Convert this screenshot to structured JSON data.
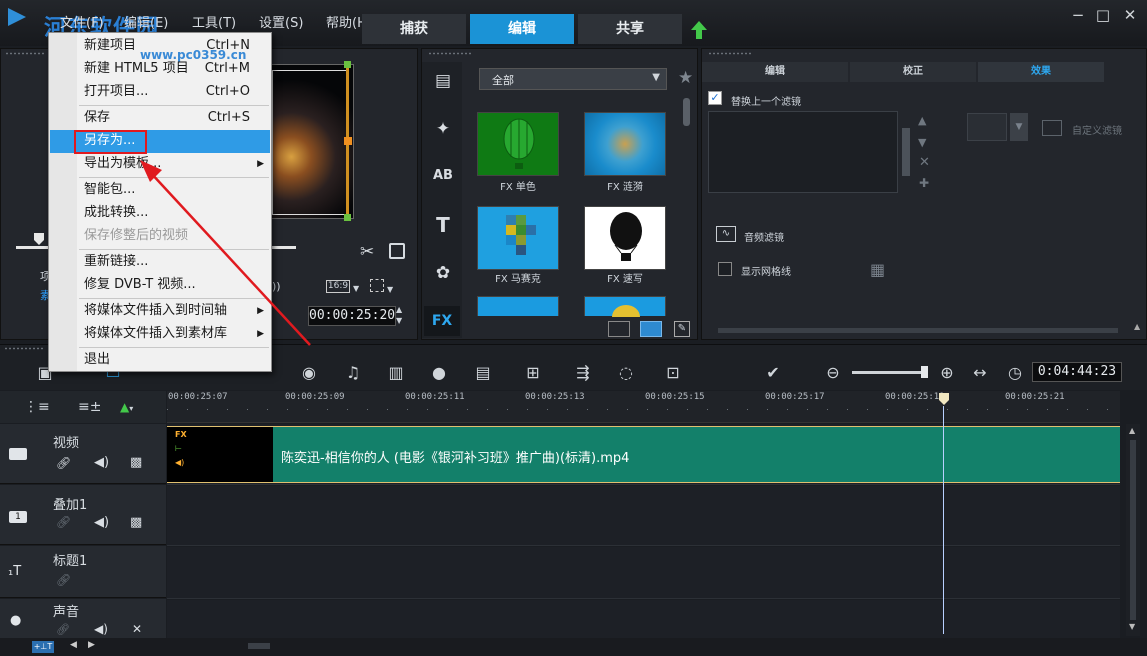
{
  "menubar": {
    "file": "文件(F)",
    "edit": "编辑(E)",
    "tools": "工具(T)",
    "settings": "设置(S)",
    "help": "帮助(H)"
  },
  "modes": {
    "capture": "捕获",
    "edit": "编辑",
    "share": "共享",
    "active": "编辑"
  },
  "watermark": {
    "text": "河东软件园",
    "url": "www.pc0359.cn"
  },
  "file_menu": {
    "items": [
      {
        "label": "新建项目",
        "shortcut": "Ctrl+N"
      },
      {
        "label": "新建 HTML5 项目",
        "shortcut": "Ctrl+M"
      },
      {
        "label": "打开项目...",
        "shortcut": "Ctrl+O"
      },
      {
        "label": "保存",
        "shortcut": "Ctrl+S"
      },
      {
        "label": "另存为..."
      },
      {
        "label": "导出为模板..."
      },
      {
        "label": "智能包..."
      },
      {
        "label": "成批转换..."
      },
      {
        "label": "保存修整后的视频"
      },
      {
        "label": "重新链接..."
      },
      {
        "label": "修复 DVB-T 视频..."
      },
      {
        "label": "将媒体文件插入到时间轴"
      },
      {
        "label": "将媒体文件插入到素材库"
      },
      {
        "label": "退出"
      }
    ]
  },
  "preview": {
    "timecode": "00:00:25:20",
    "aspect": "16:9",
    "left_label": "项",
    "left_sub": "素",
    "right_fragment": "))"
  },
  "library": {
    "filter": "全部",
    "thumbs": [
      {
        "caption": "FX 单色"
      },
      {
        "caption": "FX 涟漪"
      },
      {
        "caption": "FX 马赛克"
      },
      {
        "caption": "FX 速写"
      }
    ],
    "side_icons": [
      "media-icon",
      "instant-project-icon",
      "transition-icon",
      "title-icon",
      "graphic-icon",
      "filter-icon"
    ],
    "side_labels": {
      "transition": "AB",
      "title": "T",
      "filter": "FX"
    }
  },
  "options": {
    "tabs": [
      "编辑",
      "校正",
      "效果"
    ],
    "active_tab": "效果",
    "replace_filter": "替换上一个滤镜",
    "custom_filter": "自定义滤镜",
    "audio_filter": "音频滤镜",
    "show_grid": "显示网格线"
  },
  "timeline": {
    "total_time": "0:04:44:23",
    "ticks": [
      "00:00:25:07",
      "00:00:25:09",
      "00:00:25:11",
      "00:00:25:13",
      "00:00:25:15",
      "00:00:25:17",
      "00:00:25:19",
      "00:00:25:21"
    ],
    "tracks": [
      {
        "name": "视频"
      },
      {
        "name": "叠加1"
      },
      {
        "name": "标题1"
      },
      {
        "name": "声音"
      }
    ],
    "clip": {
      "title": "陈奕迅-相信你的人 (电影《银河补习班》推广曲)(标清).mp4",
      "fx_badge": "FX"
    }
  }
}
